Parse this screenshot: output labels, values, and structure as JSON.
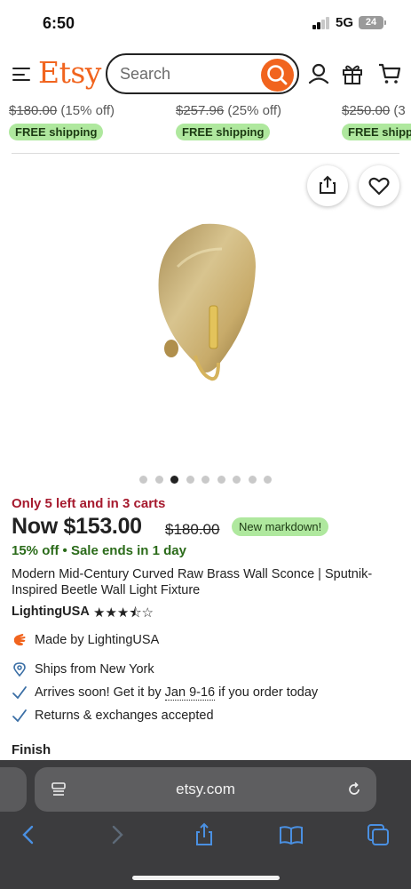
{
  "status_bar": {
    "time": "6:50",
    "network": "5G",
    "battery": "24"
  },
  "header": {
    "logo": "Etsy",
    "search": {
      "placeholder": "Search",
      "value": ""
    },
    "icons": [
      "menu-icon",
      "search-icon",
      "account-icon",
      "gift-icon",
      "cart-icon"
    ]
  },
  "carousel": [
    {
      "old_price": "$180.00",
      "discount": "(15% off)",
      "shipping": "FREE shipping"
    },
    {
      "old_price": "$257.96",
      "discount": "(25% off)",
      "shipping": "FREE shipping"
    },
    {
      "old_price": "$250.00",
      "discount": "(3",
      "shipping": "FREE shipp"
    }
  ],
  "gallery": {
    "dot_count": 9,
    "active_index": 2
  },
  "product": {
    "stock_notice": "Only 5 left and in 3 carts",
    "now_price": "Now $153.00",
    "was_price": "$180.00",
    "markdown_badge": "New markdown!",
    "discount": "15% off",
    "sale_ends": "Sale ends in 1 day",
    "title": "Modern Mid-Century Curved Raw Brass Wall Sconce | Sputnik-Inspired Beetle Wall Light Fixture",
    "shop": "LightingUSA",
    "rating_stars": "★★★⯪☆",
    "rating": 3.5
  },
  "features": {
    "made_by": "Made by LightingUSA",
    "ships_from": "Ships from New York",
    "arrives_prefix": "Arrives soon! Get it by",
    "arrives_dates": "Jan 9-16",
    "arrives_suffix": "if you order today",
    "returns": "Returns & exchanges accepted"
  },
  "finish_label": "Finish",
  "browser": {
    "url": "etsy.com"
  },
  "colors": {
    "brand": "#f1641e",
    "badge_green": "#afe89e",
    "stock_red": "#a61a2e",
    "sale_green": "#2b6b1a",
    "ios_blue": "#4a90e2"
  }
}
